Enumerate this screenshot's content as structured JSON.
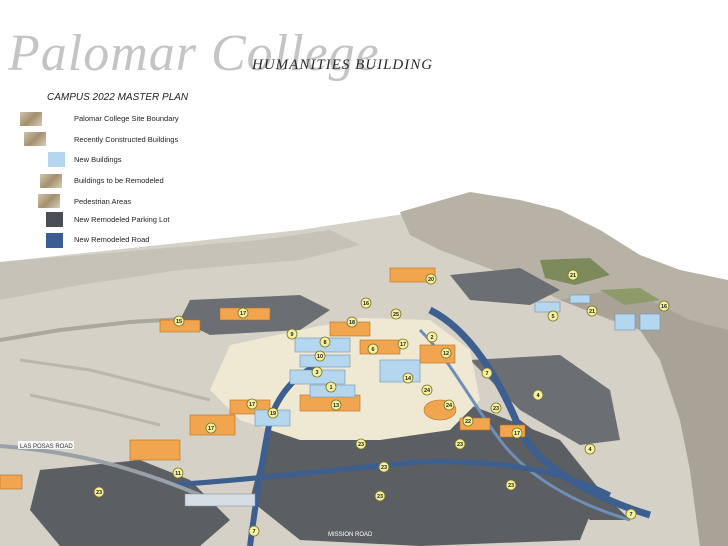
{
  "header": {
    "brand_text": "Palomar College",
    "slide_title": "HUMANITIES BUILDING"
  },
  "legend": {
    "title": "CAMPUS 2022 MASTER PLAN",
    "items": [
      {
        "label": "Palomar College Site Boundary"
      },
      {
        "label": "Recently Constructed Buildings"
      },
      {
        "label": "New Buildings",
        "color": "#b5d6ef"
      },
      {
        "label": "Buildings to be Remodeled"
      },
      {
        "label": "Pedestrian Areas"
      },
      {
        "label": "New Remodeled Parking Lot",
        "color": "#4a4e55"
      },
      {
        "label": "New Remodeled Road",
        "color": "#3a5e93"
      }
    ]
  },
  "map": {
    "colors": {
      "parking": "#5b5e62",
      "road": "#3c5f8f",
      "new_building": "#b5d6ef",
      "remodel_building": "#f0a54e",
      "pedestrian": "#efe8d2",
      "badge": "#f5f0a0"
    },
    "road_labels": {
      "las_posas": "LAS POSAS ROAD",
      "mission": "MISSION ROAD"
    },
    "building_numbers": [
      "20",
      "21",
      "16",
      "25",
      "5",
      "21",
      "16",
      "15",
      "17",
      "18",
      "9",
      "8",
      "6",
      "17",
      "2",
      "12",
      "10",
      "3",
      "7",
      "14",
      "1",
      "24",
      "4",
      "17",
      "19",
      "13",
      "24",
      "22",
      "23",
      "17",
      "17",
      "23",
      "23",
      "23",
      "23",
      "11",
      "23",
      "23",
      "7",
      "7",
      "4"
    ]
  }
}
